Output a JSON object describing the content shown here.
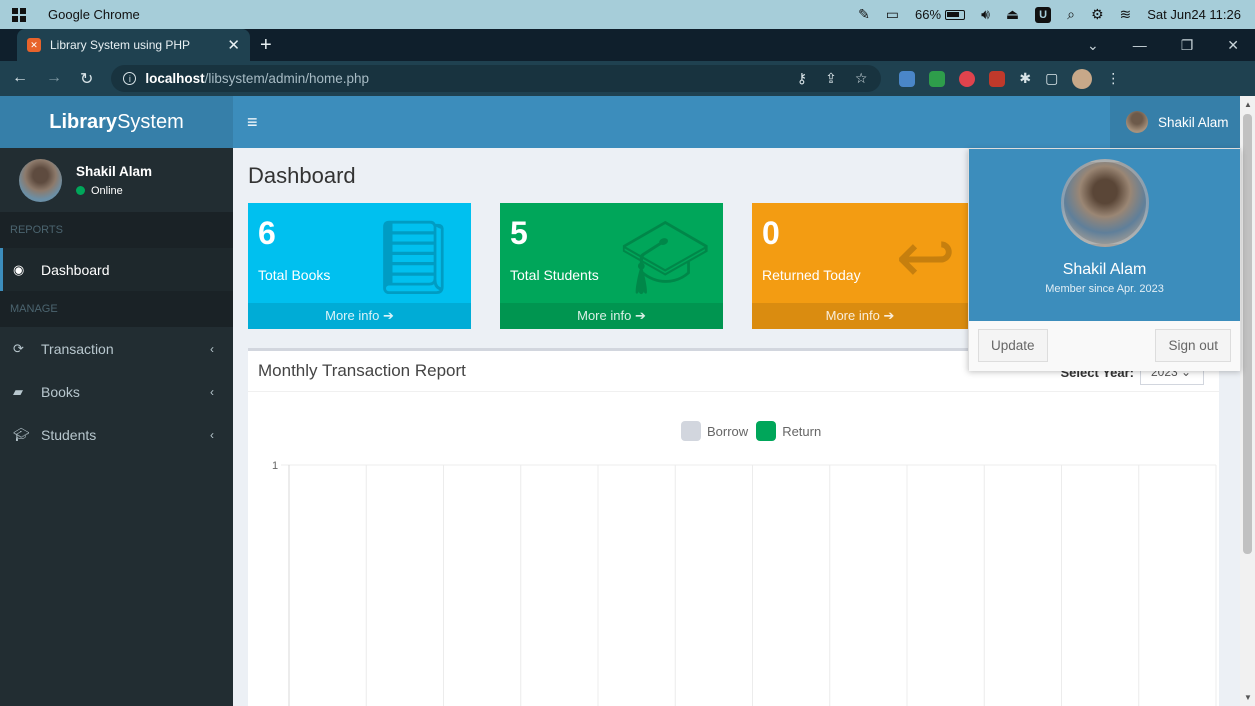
{
  "os": {
    "app_name": "Google Chrome",
    "battery": "66%",
    "clock": "Sat Jun24 11:26"
  },
  "browser": {
    "tab_title": "Library System using PHP",
    "url_host": "localhost",
    "url_path": "/libsystem/admin/home.php"
  },
  "header": {
    "logo_bold": "Library",
    "logo_rest": "System",
    "user_name": "Shakil Alam"
  },
  "sidebar": {
    "user_name": "Shakil Alam",
    "status": "Online",
    "section_reports": "REPORTS",
    "section_manage": "MANAGE",
    "items": [
      {
        "label": "Dashboard"
      },
      {
        "label": "Transaction"
      },
      {
        "label": "Books"
      },
      {
        "label": "Students"
      }
    ]
  },
  "page": {
    "title": "Dashboard"
  },
  "stats": [
    {
      "value": "6",
      "label": "Total Books",
      "more": "More info"
    },
    {
      "value": "5",
      "label": "Total Students",
      "more": "More info"
    },
    {
      "value": "0",
      "label": "Returned Today",
      "more": "More info"
    }
  ],
  "report": {
    "title": "Monthly Transaction Report",
    "year_label": "Select Year:",
    "year_value": "2023"
  },
  "chart_data": {
    "type": "bar",
    "categories": [
      "",
      "",
      "",
      "",
      "",
      "",
      "",
      "",
      "",
      "",
      "",
      "",
      ""
    ],
    "series": [
      {
        "name": "Borrow",
        "color": "#d2d6de",
        "values": [
          0,
          0,
          0,
          0,
          0,
          0,
          0,
          0,
          0,
          0,
          0,
          0,
          0
        ]
      },
      {
        "name": "Return",
        "color": "#00a65a",
        "values": [
          0,
          0,
          0,
          0,
          0,
          0,
          0,
          0,
          0,
          0,
          0,
          0,
          0
        ]
      }
    ],
    "yticks": [
      "1"
    ],
    "ylim": [
      0,
      1
    ],
    "grid": true,
    "legend": "top-center"
  },
  "dropdown": {
    "name": "Shakil Alam",
    "member_since": "Member since Apr. 2023",
    "update_label": "Update",
    "signout_label": "Sign out"
  },
  "colors": {
    "accent": "#3c8dbc",
    "aqua": "#00c0ef",
    "green": "#00a65a",
    "yellow": "#f39c12",
    "sidebar": "#222d32"
  }
}
